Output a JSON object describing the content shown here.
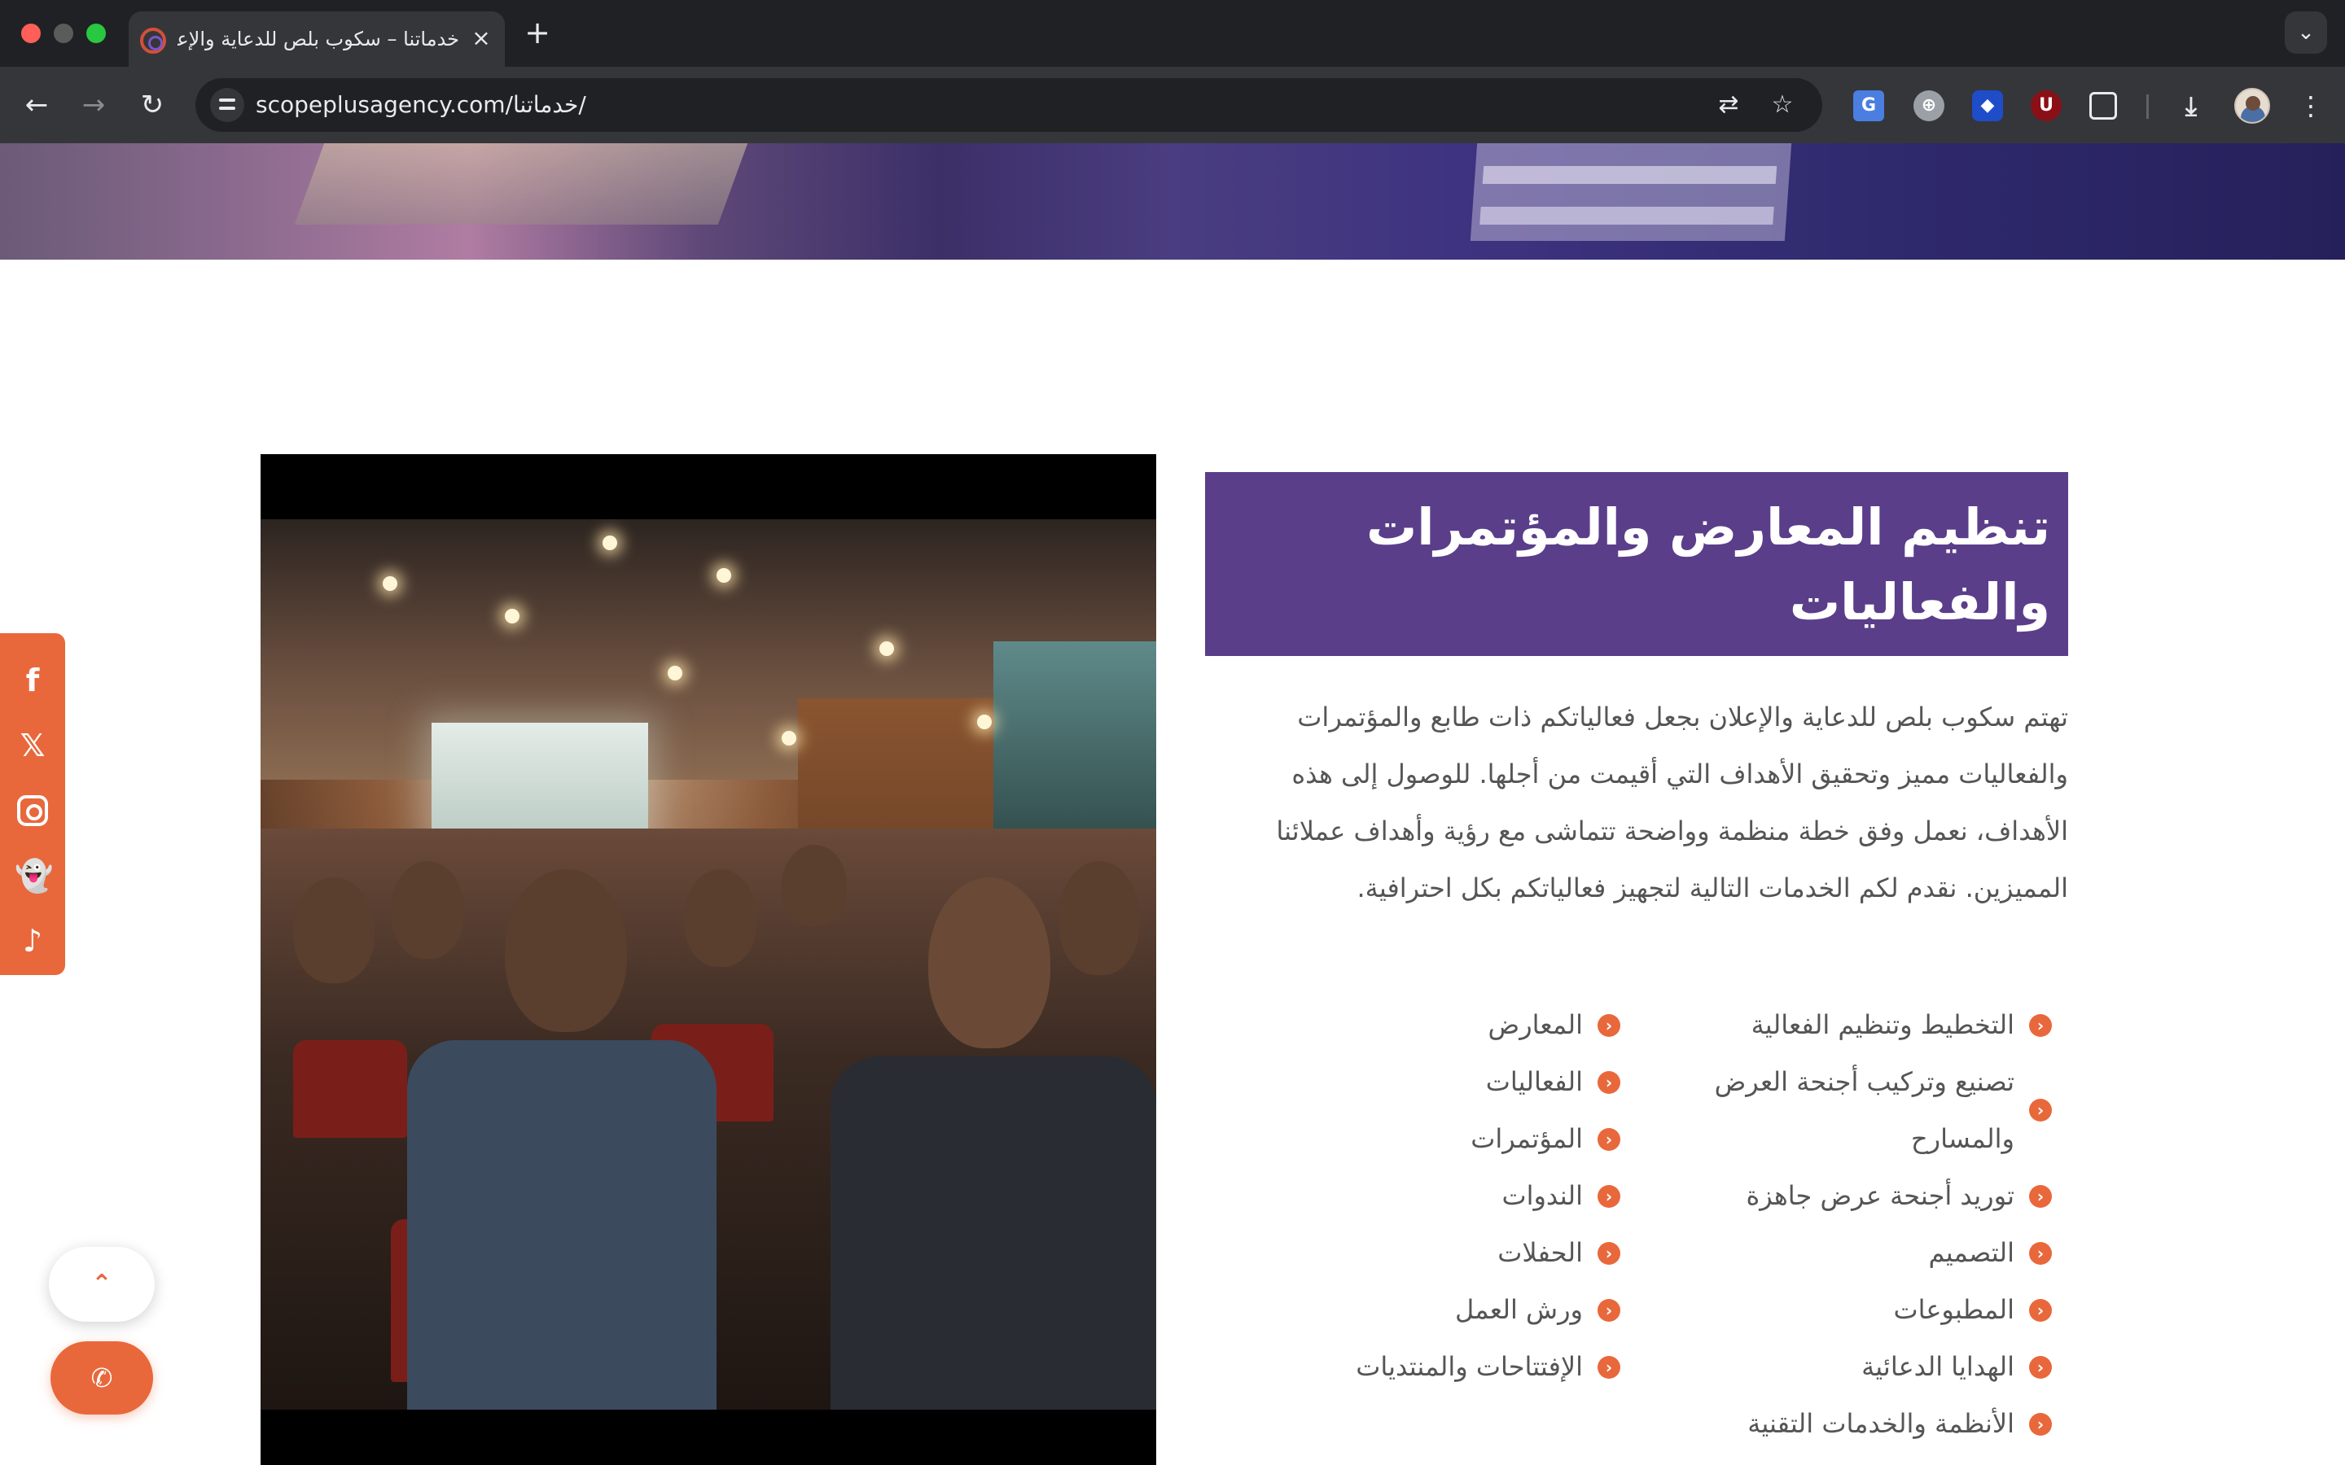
{
  "browser": {
    "tab_title": "خدماتنا – سكوب بلص للدعاية والإعلان",
    "tab_close": "×",
    "new_tab": "+",
    "tab_menu": "⌄",
    "url": "scopeplusagency.com/خدماتنا/",
    "nav": {
      "back": "←",
      "forward": "→",
      "reload": "↻"
    },
    "icons": [
      "site-info-icon",
      "translate-icon",
      "star-icon",
      "google-translate-extension-icon",
      "globe-extension-icon",
      "bitwarden-extension-icon",
      "ublock-extension-icon",
      "extensions-puzzle-icon",
      "download-icon",
      "profile-avatar",
      "menu-kebab-icon"
    ]
  },
  "social": [
    {
      "name": "facebook",
      "glyph": "f"
    },
    {
      "name": "x",
      "glyph": "𝕏"
    },
    {
      "name": "instagram",
      "glyph": ""
    },
    {
      "name": "snapchat",
      "glyph": "👻"
    },
    {
      "name": "tiktok",
      "glyph": "♪"
    }
  ],
  "floating": {
    "scroll_top": "⌃",
    "call": "✆"
  },
  "content": {
    "title": "تنظيم المعارض والمؤتمرات والفعاليات",
    "intro": "تهتم سكوب بلص للدعاية والإعلان بجعل فعالياتكم ذات طابع والمؤتمرات والفعاليات مميز وتحقيق الأهداف التي أقيمت من أجلها. للوصول إلى هذه الأهداف، نعمل وفق خطة منظمة وواضحة تتماشى مع رؤية وأهداف عملائنا المميزين. نقدم لكم الخدمات التالية لتجهيز فعالياتكم بكل احترافية.",
    "services_right": [
      "التخطيط وتنظيم الفعالية",
      "تصنيع وتركيب أجنحة العرض والمسارح",
      "توريد أجنحة عرض جاهزة",
      "التصميم",
      "المطبوعات",
      "الهدايا الدعائية",
      "الأنظمة والخدمات التقنية"
    ],
    "services_left": [
      "المعارض",
      "الفعاليات",
      "المؤتمرات",
      "الندوات",
      "الحفلات",
      "ورش العمل",
      "الإفتتاحات والمنتديات"
    ],
    "bullet": "‹"
  },
  "colors": {
    "accent": "#e8683c",
    "title_bg": "#5a3e8a",
    "text": "#555555"
  }
}
